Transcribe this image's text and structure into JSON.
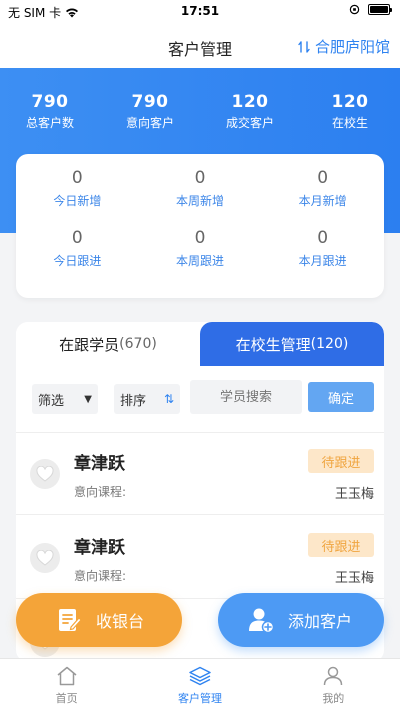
{
  "status_bar": {
    "carrier": "无 SIM 卡",
    "time": "17:51"
  },
  "nav": {
    "title": "客户管理",
    "location": "合肥庐阳馆",
    "location_icon": "swap-icon"
  },
  "summary": [
    {
      "value": "790",
      "label": "总客户数"
    },
    {
      "value": "790",
      "label": "意向客户"
    },
    {
      "value": "120",
      "label": "成交客户"
    },
    {
      "value": "120",
      "label": "在校生"
    }
  ],
  "activity": [
    {
      "value": "0",
      "label": "今日新增"
    },
    {
      "value": "0",
      "label": "本周新增"
    },
    {
      "value": "0",
      "label": "本月新增"
    },
    {
      "value": "0",
      "label": "今日跟进"
    },
    {
      "value": "0",
      "label": "本周跟进"
    },
    {
      "value": "0",
      "label": "本月跟进"
    }
  ],
  "tabs": [
    {
      "label": "在跟学员",
      "count": "(670)"
    },
    {
      "label": "在校生管理",
      "count": "(120)"
    }
  ],
  "filters": {
    "filter_label": "筛选",
    "sort_label": "排序",
    "search_placeholder": "学员搜索",
    "confirm_label": "确定"
  },
  "students": [
    {
      "name": "章津跃",
      "course_label": "意向课程:",
      "status": "待跟进",
      "advisor": "王玉梅"
    },
    {
      "name": "章津跃",
      "course_label": "意向课程:",
      "status": "待跟进",
      "advisor": "王玉梅"
    }
  ],
  "actions": {
    "cashier": "收银台",
    "add_customer": "添加客户"
  },
  "tabbar": [
    {
      "label": "首页",
      "icon": "home-icon"
    },
    {
      "label": "客户管理",
      "icon": "layers-icon"
    },
    {
      "label": "我的",
      "icon": "user-icon"
    }
  ],
  "colors": {
    "primary": "#2f83f0",
    "hero": "#3d8ff3",
    "pending": "#f0a540",
    "cashier": "#f4a439"
  }
}
